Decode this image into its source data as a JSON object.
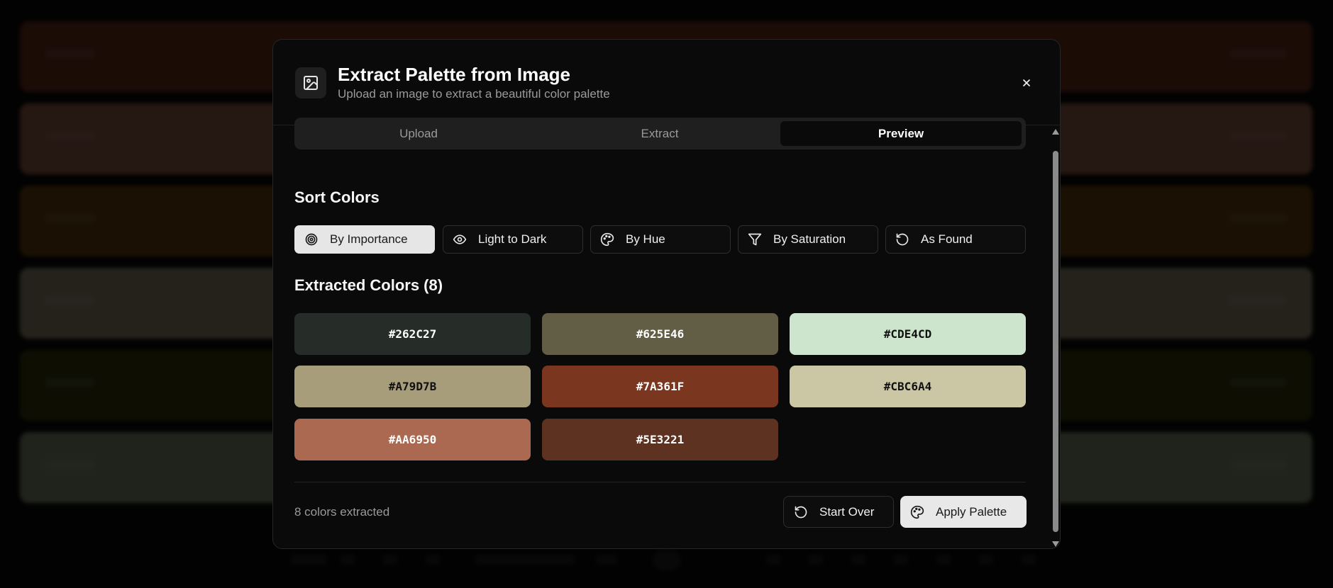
{
  "background": {
    "stripe_colors": [
      "#7A361F",
      "#AA6950",
      "#7a4a12",
      "#A79D7B",
      "#3f4210",
      "#8ea07a"
    ]
  },
  "modal": {
    "title": "Extract Palette from Image",
    "subtitle": "Upload an image to extract a beautiful color palette",
    "header_icon": "image-icon",
    "close_icon": "close-icon"
  },
  "tabs": [
    {
      "label": "Upload",
      "active": false
    },
    {
      "label": "Extract",
      "active": false
    },
    {
      "label": "Preview",
      "active": true
    }
  ],
  "sort": {
    "title": "Sort Colors",
    "options": [
      {
        "label": "By Importance",
        "icon": "target-icon",
        "active": true
      },
      {
        "label": "Light to Dark",
        "icon": "eye-icon",
        "active": false
      },
      {
        "label": "By Hue",
        "icon": "palette-icon",
        "active": false
      },
      {
        "label": "By Saturation",
        "icon": "filter-icon",
        "active": false
      },
      {
        "label": "As Found",
        "icon": "rotate-ccw-icon",
        "active": false
      }
    ]
  },
  "extracted": {
    "title": "Extracted Colors (8)",
    "colors": [
      {
        "hex": "#262C27",
        "text_color": "#ffffff"
      },
      {
        "hex": "#625E46",
        "text_color": "#ffffff"
      },
      {
        "hex": "#CDE4CD",
        "text_color": "#111111"
      },
      {
        "hex": "#A79D7B",
        "text_color": "#111111"
      },
      {
        "hex": "#7A361F",
        "text_color": "#ffffff"
      },
      {
        "hex": "#CBC6A4",
        "text_color": "#111111"
      },
      {
        "hex": "#AA6950",
        "text_color": "#ffffff"
      },
      {
        "hex": "#5E3221",
        "text_color": "#ffffff"
      }
    ]
  },
  "footer": {
    "status": "8 colors extracted",
    "start_over_label": "Start Over",
    "start_over_icon": "rotate-ccw-icon",
    "apply_label": "Apply Palette",
    "apply_icon": "palette-icon"
  }
}
